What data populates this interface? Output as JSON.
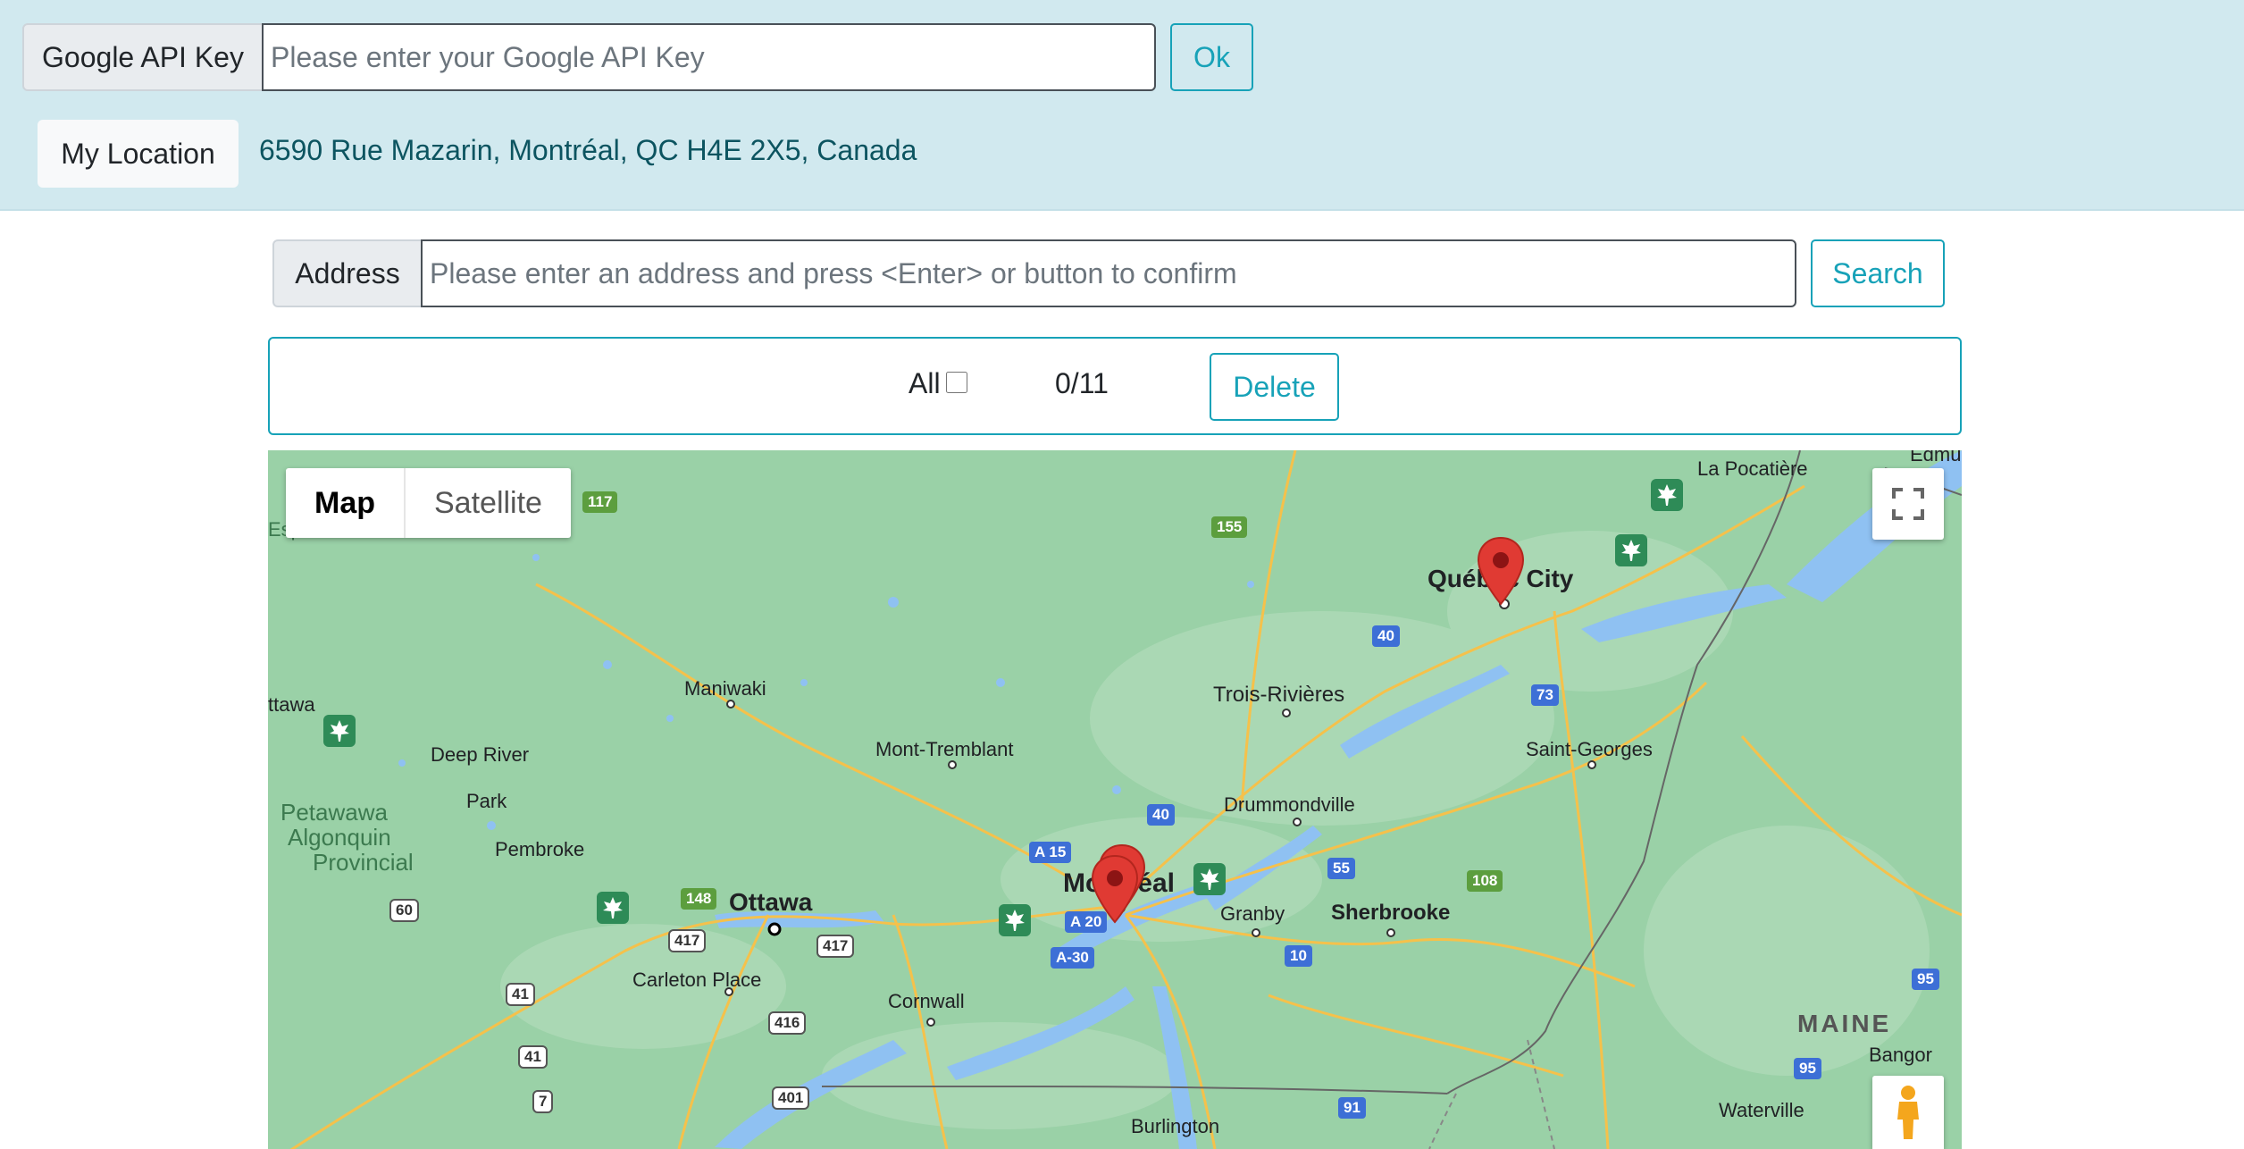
{
  "api_key": {
    "prefix": "Google API Key",
    "placeholder": "Please enter your Google API Key",
    "ok_label": "Ok"
  },
  "location": {
    "button_label": "My Location",
    "address": "6590 Rue Mazarin, Montréal, QC H4E 2X5, Canada"
  },
  "address_search": {
    "prefix": "Address",
    "placeholder": "Please enter an address and press <Enter> or button to confirm",
    "search_label": "Search"
  },
  "selection": {
    "all_label": "All",
    "all_checked": false,
    "count": "0/11",
    "delete_label": "Delete"
  },
  "map": {
    "type_tabs": [
      "Map",
      "Satellite"
    ],
    "active_tab": "Map",
    "place_labels": [
      "Edmu",
      "La Pocatière",
      "Québec City",
      "Trois-Rivières",
      "Saint-Georges",
      "Maniwaki",
      "Mont-Tremblant",
      "Drummondville",
      "ttawa",
      "Deep River",
      "Petawawa",
      "Algonquin",
      "Provincial",
      "Park",
      "Pembroke",
      "Ottawa",
      "Montréal",
      "Granby",
      "Sherbrooke",
      "Carleton Place",
      "Cornwall",
      "MAINE",
      "Bangor",
      "Waterville",
      "Burlington",
      "Espanola"
    ],
    "road_shields": [
      "117",
      "155",
      "40",
      "73",
      "40",
      "A 15",
      "A 20",
      "A-30",
      "148",
      "417",
      "417",
      "60",
      "41",
      "41",
      "7",
      "416",
      "401",
      "55",
      "10",
      "108",
      "91",
      "95",
      "95"
    ],
    "markers": 3,
    "icons": {
      "fullscreen": "fullscreen-icon",
      "pegman": "pegman-icon",
      "marker": "map-marker-icon",
      "park": "maple-leaf-park-icon"
    }
  },
  "colors": {
    "accent": "#17a2b8",
    "topbar_bg": "#d1e9ef",
    "location_text": "#0c5460",
    "map_land": "#9ad1a7",
    "map_water": "#9ec5f8",
    "marker_red": "#e03a33"
  }
}
